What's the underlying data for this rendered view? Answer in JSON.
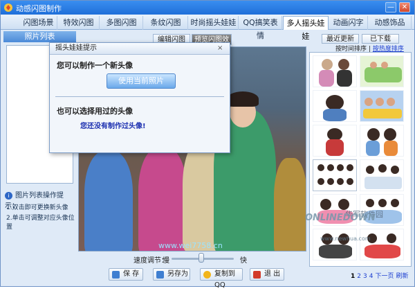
{
  "window": {
    "title": "动感闪图制作",
    "minimize": "—",
    "close": "✕"
  },
  "tabs": [
    "闪图场景",
    "特效闪图",
    "多图闪图",
    "条纹闪图",
    "时尚摇头娃娃",
    "QQ搞笑表情",
    "多人摇头娃娃",
    "动画闪字",
    "动感饰品"
  ],
  "active_tab": 6,
  "left": {
    "list_title": "照片列表",
    "help_title": "图片列表操作提示：",
    "help_items": [
      "1.双击即可更换新头像",
      "2.单击可调整对应头像位置"
    ]
  },
  "center": {
    "subtabs": [
      "编辑闪图",
      "预览闪图效果"
    ],
    "active_subtab": 1,
    "watermark": "www.wei7758.cn",
    "speed_label": "速度调节：",
    "speed_slow": "慢",
    "speed_fast": "快",
    "speed_value": 0.48,
    "buttons": [
      "保 存",
      "另存为",
      "复制到QQ",
      "退 出"
    ],
    "button_icons": [
      "save-icon",
      "save-as-icon",
      "qq-icon",
      "exit-icon"
    ],
    "button_colors": [
      "#3f7fd1",
      "#3f7fd1",
      "#f2b51b",
      "#d23a2a"
    ]
  },
  "right": {
    "tabs": [
      "最近更新",
      "已下载"
    ],
    "sort_by_time": "按时间排序",
    "sort_sep": "|",
    "sort_by_hot": "按热度排序",
    "pager": [
      "1",
      "2",
      "3",
      "4",
      "下一页",
      "刷新"
    ],
    "current_page": "1",
    "wm_cn": "华军软件园",
    "wm_en": "ONLINEDOWN",
    "wm_url": "www.newhua.com"
  },
  "dialog": {
    "title": "摇头娃娃提示",
    "close": "×",
    "q1": "您可以制作一个新头像",
    "use_photo_button": "使用当前照片",
    "q2": "也可以选择用过的头像",
    "note": "您还没有制作过头像!"
  }
}
